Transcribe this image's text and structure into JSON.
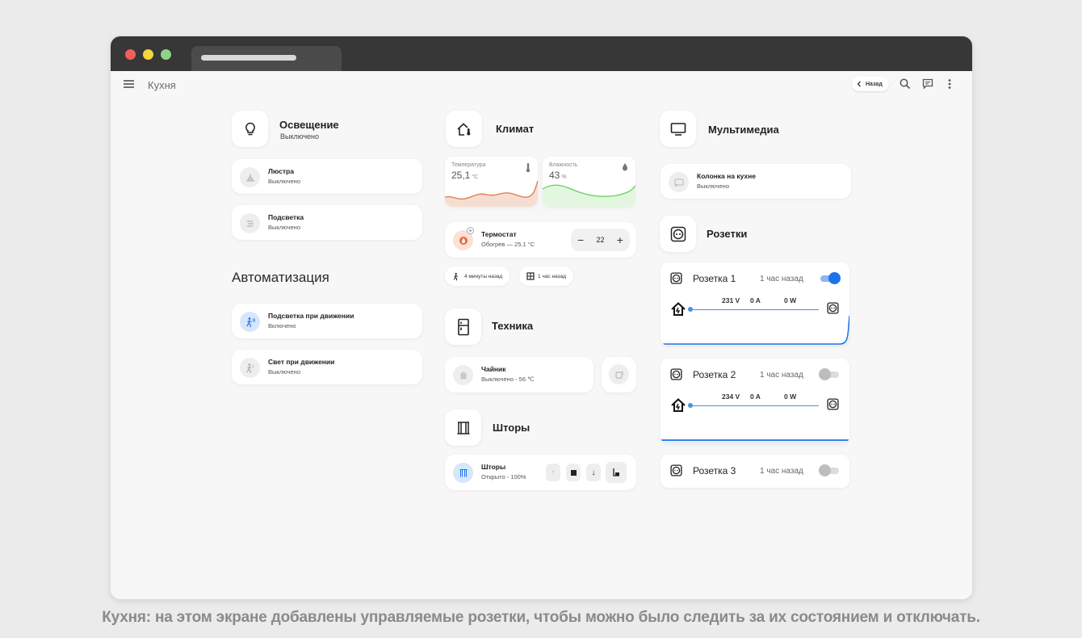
{
  "header": {
    "title": "Кухня",
    "back_label": "Назад"
  },
  "lighting": {
    "title": "Освещение",
    "state": "Выключено",
    "items": [
      {
        "name": "Люстра",
        "state": "Выключено"
      },
      {
        "name": "Подсветка",
        "state": "Выключено"
      }
    ]
  },
  "automation": {
    "heading": "Автоматизация",
    "items": [
      {
        "name": "Подсветка при движении",
        "state": "Включено"
      },
      {
        "name": "Свет при движении",
        "state": "Выключено"
      }
    ]
  },
  "climate": {
    "title": "Климат",
    "temperature": {
      "label": "Температура",
      "value": "25,1",
      "unit": "°C"
    },
    "humidity": {
      "label": "Влажность",
      "value": "43",
      "unit": "%"
    },
    "thermostat": {
      "name": "Термостат",
      "state": "Обогрев — 25,1 °C",
      "setpoint": "22",
      "minus": "−",
      "plus": "+"
    },
    "chips": [
      {
        "icon": "motion-icon",
        "label": "4 минуты назад"
      },
      {
        "icon": "window-icon",
        "label": "1 час назад"
      }
    ]
  },
  "appliances": {
    "title": "Техника",
    "kettle": {
      "name": "Чайник",
      "state": "Выключено - 56 ℃"
    }
  },
  "curtains": {
    "title": "Шторы",
    "item": {
      "name": "Шторы",
      "state": "Открыто - 100%"
    }
  },
  "media": {
    "title": "Мультимедиа",
    "item": {
      "name": "Колонка на кухне",
      "state": "Выключено"
    }
  },
  "sockets": {
    "title": "Розетки",
    "items": [
      {
        "name": "Розетка 1",
        "time": "1 час назад",
        "on": true,
        "voltage": "231 V",
        "current": "0 A",
        "power": "0 W"
      },
      {
        "name": "Розетка 2",
        "time": "1 час назад",
        "on": false,
        "voltage": "234 V",
        "current": "0 A",
        "power": "0 W"
      },
      {
        "name": "Розетка 3",
        "time": "1 час назад",
        "on": false
      }
    ]
  },
  "colors": {
    "accent": "#1a73e8",
    "temperature_line": "#e07a45",
    "humidity_line": "#63d25a"
  },
  "caption": "Кухня: на этом экране добавлены управляемые розетки, чтобы можно было следить за их состоянием и отключать."
}
